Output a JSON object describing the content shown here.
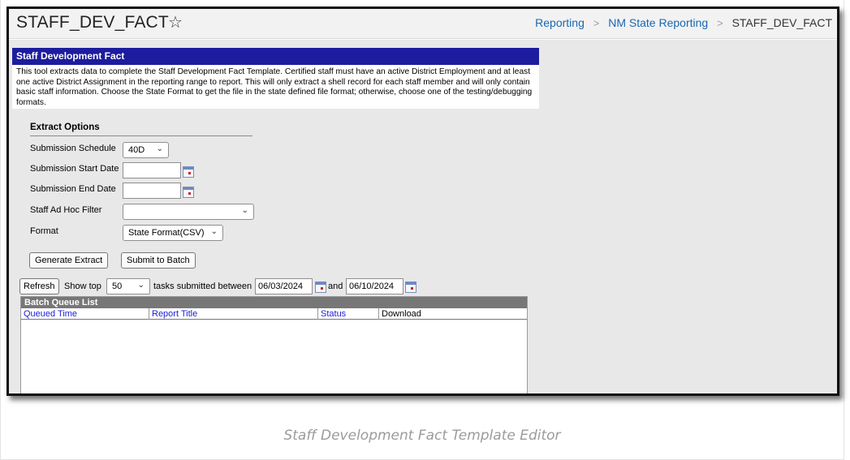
{
  "header": {
    "title": "STAFF_DEV_FACT",
    "favorite_icon": "star-outline-icon",
    "breadcrumb": {
      "items": [
        "Reporting",
        "NM State Reporting"
      ],
      "separator": ">",
      "current": "STAFF_DEV_FACT"
    }
  },
  "tool": {
    "header": "Staff Development Fact",
    "description": "This tool extracts data to complete the Staff Development Fact Template. Certified staff must have an active District Employment and at least one active District Assignment in the reporting range to report. This will only extract a shell record for each staff member and will only contain basic staff information. Choose the State Format to get the file in the state defined file format; otherwise, choose one of the testing/debugging formats."
  },
  "extract_options": {
    "title": "Extract Options",
    "submission_schedule": {
      "label": "Submission Schedule",
      "value": "40D"
    },
    "start_date": {
      "label": "Submission Start Date",
      "value": ""
    },
    "end_date": {
      "label": "Submission End Date",
      "value": ""
    },
    "ad_hoc_filter": {
      "label": "Staff Ad Hoc Filter",
      "value": ""
    },
    "format": {
      "label": "Format",
      "value": "State Format(CSV)"
    },
    "generate_label": "Generate Extract",
    "submit_batch_label": "Submit to Batch"
  },
  "batch_controls": {
    "refresh_label": "Refresh",
    "show_top_label": "Show top",
    "show_top_value": "50",
    "tasks_label": "tasks submitted between",
    "from_date": "06/03/2024",
    "and_label": "and",
    "to_date": "06/10/2024"
  },
  "batch_queue": {
    "title": "Batch Queue List",
    "columns": [
      "Queued Time",
      "Report Title",
      "Status",
      "Download"
    ],
    "rows": []
  },
  "caption": "Staff Development Fact Template Editor",
  "colors": {
    "tool_header_bg": "#1c1c9e",
    "link": "#1b67b1",
    "batch_header_bg": "#777777"
  }
}
